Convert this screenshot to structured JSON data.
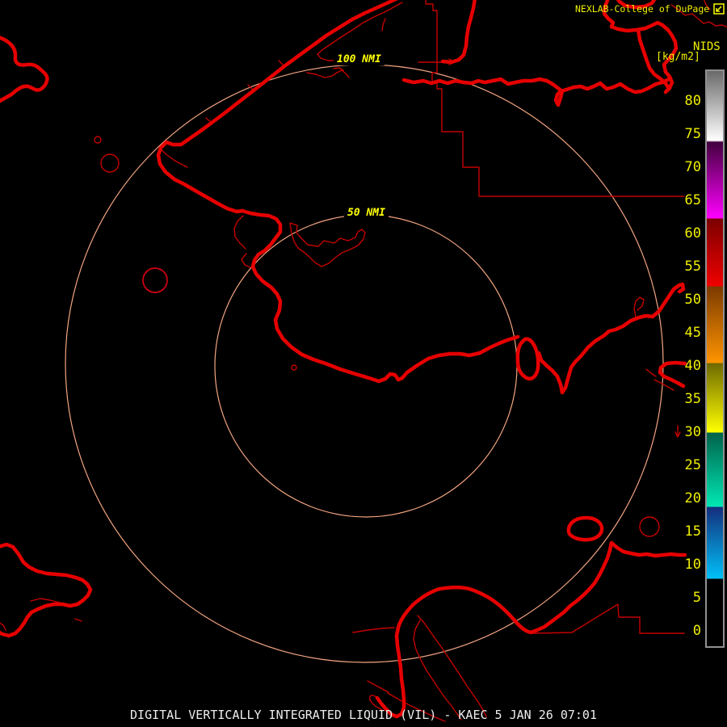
{
  "header": {
    "title": "NEXLAB-College of DuPage"
  },
  "colorbar": {
    "product_label": "NIDS",
    "unit_label": "[kg/m2]",
    "ticks": [
      "80",
      "75",
      "70",
      "65",
      "60",
      "55",
      "50",
      "45",
      "40",
      "35",
      "30",
      "25",
      "20",
      "15",
      "10",
      "5",
      "0"
    ],
    "gradient": [
      {
        "at": 0.0,
        "c": "#6a6a6a"
      },
      {
        "at": 0.1208,
        "c": "#ffffff"
      },
      {
        "at": 0.1236,
        "c": "#42003e"
      },
      {
        "at": 0.2556,
        "c": "#ff00ff"
      },
      {
        "at": 0.257,
        "c": "#7c0000"
      },
      {
        "at": 0.3736,
        "c": "#f00000"
      },
      {
        "at": 0.375,
        "c": "#7c3a00"
      },
      {
        "at": 0.507,
        "c": "#ff9400"
      },
      {
        "at": 0.5084,
        "c": "#6f6a00"
      },
      {
        "at": 0.6278,
        "c": "#ffff00"
      },
      {
        "at": 0.6292,
        "c": "#00624a"
      },
      {
        "at": 0.757,
        "c": "#00e8b4"
      },
      {
        "at": 0.7584,
        "c": "#142e7c"
      },
      {
        "at": 0.882,
        "c": "#00c0f8"
      },
      {
        "at": 0.8834,
        "c": "#000000"
      },
      {
        "at": 1.0,
        "c": "#000000"
      }
    ]
  },
  "rings": [
    {
      "label": "100 NMI"
    },
    {
      "label": "50 NMI"
    }
  ],
  "caption": "DIGITAL VERTICALLY INTEGRATED LIQUID (VIL) - KAEC 5 JAN 26 07:01",
  "colors": {
    "background": "#000000",
    "map_thick": "#e60000",
    "map_thin": "#c40000",
    "map_darkred": "#bb0011",
    "ring": "#f4a582",
    "label_yellow": "#f0ef00",
    "nmi_yellow": "#ffff00",
    "caption_white": "#ededed",
    "colorbar_border": "#909090"
  }
}
